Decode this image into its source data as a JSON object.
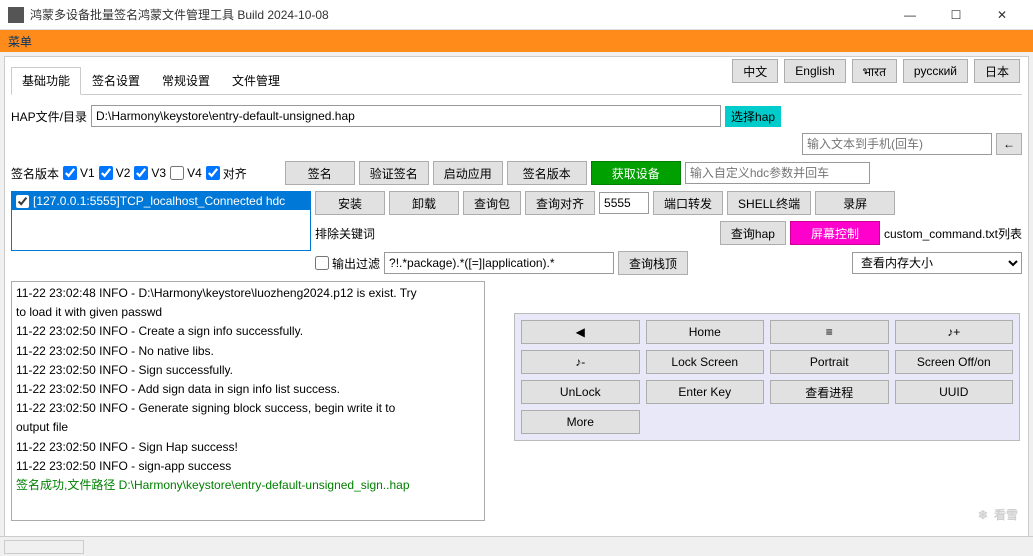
{
  "window": {
    "title": "鸿蒙多设备批量签名鸿蒙文件管理工具 Build 2024-10-08",
    "min": "—",
    "max": "☐",
    "close": "✕"
  },
  "menubar": {
    "menu": "菜单"
  },
  "lang": {
    "zh": "中文",
    "en": "English",
    "in": "भारत",
    "ru": "русский",
    "jp": "日本"
  },
  "tabs": {
    "t0": "基础功能",
    "t1": "签名设置",
    "t2": "常规设置",
    "t3": "文件管理"
  },
  "hap": {
    "label": "HAP文件/目录",
    "path": "D:\\Harmony\\keystore\\entry-default-unsigned.hap",
    "select": "选择hap",
    "phone_placeholder": "输入文本到手机(回车)"
  },
  "sign": {
    "label": "签名版本",
    "v1": "V1",
    "v2": "V2",
    "v3": "V3",
    "v4": "V4",
    "align": "对齐",
    "sign": "签名",
    "verify": "验证签名",
    "launch": "启动应用",
    "ver": "签名版本",
    "getdev": "获取设备",
    "hdc_placeholder": "输入自定义hdc参数并回车"
  },
  "dev": {
    "item": "[127.0.0.1:5555]TCP_localhost_Connected hdc",
    "install": "安装",
    "uninstall": "卸载",
    "querypkg": "查询包",
    "queryalign": "查询对齐",
    "port": "5555",
    "portfwd": "端口转发",
    "shell": "SHELL终端",
    "record": "录屏"
  },
  "filter": {
    "label": "排除关键词",
    "out": "输出过滤",
    "pattern": "?!.*package).*([=]|application).*",
    "queryhap": "查询hap",
    "screenctrl": "屏幕控制",
    "cmdlist": "custom_command.txt列表",
    "querystack": "查询栈顶",
    "memsize": "查看内存大小"
  },
  "log": {
    "l0": "11-22 23:02:48 INFO  - D:\\Harmony\\keystore\\luozheng2024.p12 is exist. Try",
    "l1": "to load it with given passwd",
    "l2": "11-22 23:02:50 INFO  - Create a sign info successfully.",
    "l3": "11-22 23:02:50 INFO  - No native libs.",
    "l4": "11-22 23:02:50 INFO  - Sign successfully.",
    "l5": "11-22 23:02:50 INFO  - Add sign data in sign info list success.",
    "l6": "11-22 23:02:50 INFO  - Generate signing block success, begin write it to",
    "l7": "output file",
    "l8": "11-22 23:02:50 INFO  - Sign Hap success!",
    "l9": "11-22 23:02:50 INFO  - sign-app success",
    "l10": "签名成功,文件路径 D:\\Harmony\\keystore\\entry-default-unsigned_sign..hap"
  },
  "ctrl": {
    "back": "◀",
    "home": "Home",
    "menu": "≡",
    "noteplus": "♪+",
    "noteminus": "♪-",
    "lock": "Lock Screen",
    "portrait": "Portrait",
    "screenoff": "Screen Off/on",
    "unlock": "UnLock",
    "enter": "Enter Key",
    "proc": "查看进程",
    "uuid": "UUID",
    "more": "More"
  },
  "watermark": "看雪"
}
